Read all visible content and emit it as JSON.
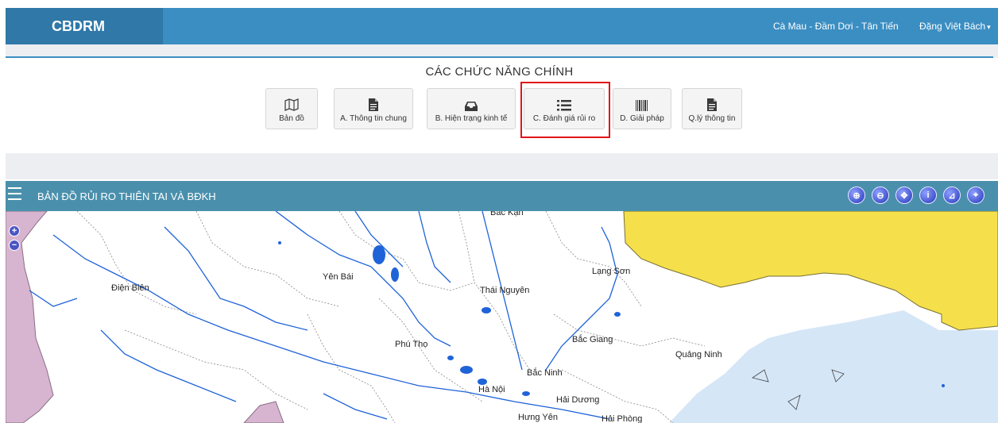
{
  "navbar": {
    "brand": "CBDRM",
    "location": "Cà Mau - Đầm Dơi - Tân Tiến",
    "user": "Đặng Việt Bách"
  },
  "functions": {
    "title": "CÁC CHỨC NĂNG CHÍNH",
    "buttons": [
      {
        "label": "Bản đồ",
        "icon": "map-icon"
      },
      {
        "label": "A. Thông tin chung",
        "icon": "document-icon"
      },
      {
        "label": "B. Hiện trạng kinh tế",
        "icon": "inbox-icon"
      },
      {
        "label": "C. Đánh giá rủi ro",
        "icon": "list-icon"
      },
      {
        "label": "D. Giải pháp",
        "icon": "barcode-icon"
      },
      {
        "label": "Q.lý thông tin",
        "icon": "document-icon"
      }
    ],
    "highlighted": "C. Đánh giá rủi ro",
    "highlight_color": "#e3141a"
  },
  "map": {
    "title": "BẢN ĐỒ RỦI RO THIÊN TAI VÀ BĐKH",
    "tools": [
      "zoom-in-tool-icon",
      "zoom-out-tool-icon",
      "pan-tool-icon",
      "info-tool-icon",
      "measure-tool-icon",
      "location-tool-icon"
    ],
    "zoom_in": "+",
    "zoom_out": "−",
    "places": {
      "bac_kan": "Bắc Kạn",
      "lang_son": "Lạng Sơn",
      "dien_bien": "Điện Biên",
      "yen_bai": "Yên Bái",
      "thai_nguyen": "Thái Nguyên",
      "bac_giang": "Bắc Giang",
      "quang_ninh": "Quảng Ninh",
      "phu_tho": "Phú Thọ",
      "bac_ninh": "Bắc Ninh",
      "ha_noi": "Hà Nội",
      "hai_duong": "Hải Dương",
      "hung_yen": "Hưng Yên",
      "hai_phong": "Hải Phòng"
    },
    "colors": {
      "border_region": "#d7b4cf",
      "coastal_region": "#f5e04c",
      "sea": "#d5e6f7",
      "river": "#1e63d8"
    }
  }
}
